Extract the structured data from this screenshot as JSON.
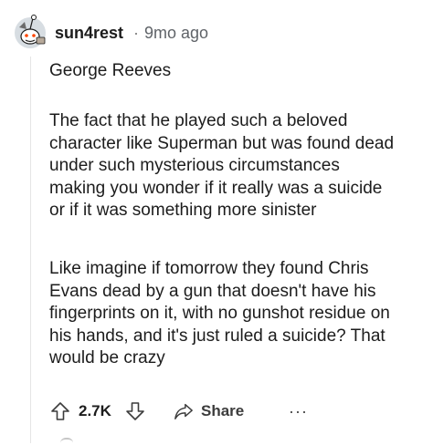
{
  "comment": {
    "username": "sun4rest",
    "separator": "·",
    "timestamp": "9mo ago",
    "paragraphs": [
      "George Reeves",
      "The fact that he played such a beloved\ncharacter like Superman but was found dead\nunder such mysterious circumstances\nmaking you wonder if it really was a suicide\nor if it was something more sinister",
      "Like imagine if tomorrow they found Chris\nEvans dead by a gun that doesn't have his\nfingerprints on it, with no gunshot residue on\nhis hands, and it's just ruled a suicide? That\nwould be crazy"
    ]
  },
  "actions": {
    "upvote_icon": "arrow-up-icon",
    "score": "2.7K",
    "downvote_icon": "arrow-down-icon",
    "share_icon": "share-arrow-icon",
    "share_label": "Share",
    "more_label": "···"
  },
  "colors": {
    "text": "#1c1c1c",
    "meta": "#5f6368",
    "thread_line": "#e5e5e5",
    "icon": "#3c3c3c"
  }
}
